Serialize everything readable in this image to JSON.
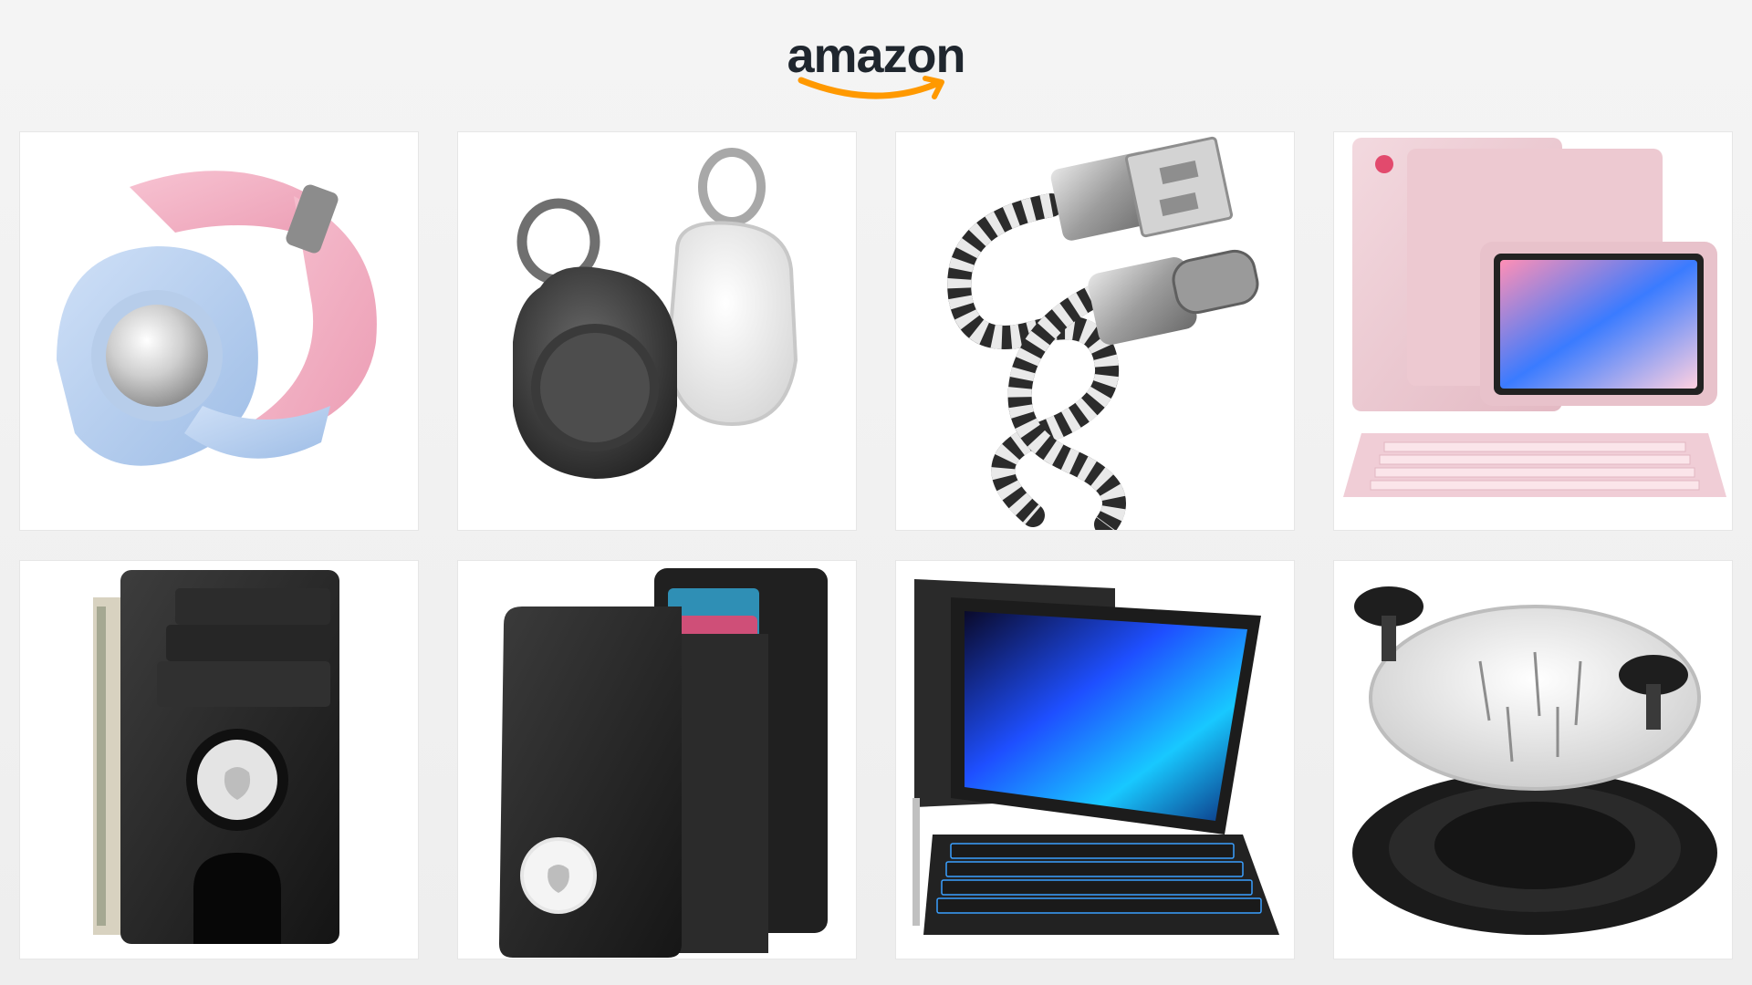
{
  "brand": {
    "name": "amazon",
    "text_color": "#1f262e",
    "smile_color": "#ff9900"
  },
  "products": [
    {
      "icon": "kids-watch-band-tracker-holder-icon",
      "colors": [
        "#a9c8ee",
        "#f2a9bf"
      ]
    },
    {
      "icon": "tracker-keychain-case-icon",
      "colors": [
        "#3a3a3a",
        "#e8e8e8"
      ]
    },
    {
      "icon": "braided-usb-c-cable-icon",
      "colors": [
        "#9a9a9a",
        "#2b2b2b"
      ]
    },
    {
      "icon": "pink-tablet-keyboard-case-icon",
      "colors": [
        "#eac4cc",
        "#f5d6dd"
      ]
    },
    {
      "icon": "slim-wallet-tracker-slot-icon",
      "colors": [
        "#1e1e1e",
        "#3a3a3a"
      ]
    },
    {
      "icon": "bifold-wallet-tracker-icon",
      "colors": [
        "#232323",
        "#cf4f78"
      ]
    },
    {
      "icon": "tablet-backlit-keyboard-case-icon",
      "colors": [
        "#1a1a1a",
        "#2e8bff"
      ]
    },
    {
      "icon": "herb-grinder-icon",
      "colors": [
        "#1b1b1b",
        "#dcdcdc"
      ]
    }
  ]
}
